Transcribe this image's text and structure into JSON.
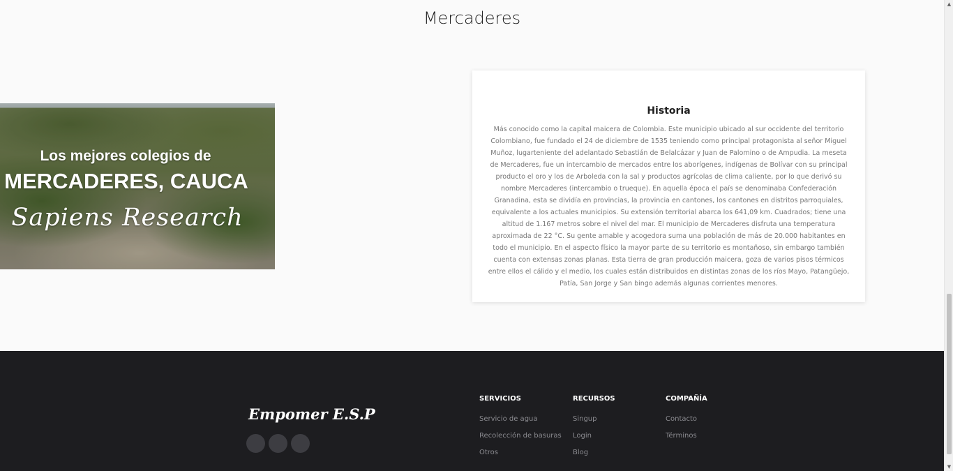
{
  "page": {
    "title": "Mercaderes"
  },
  "hero": {
    "line1": "Los mejores colegios de",
    "line2": "MERCADERES, CAUCA",
    "line3": "Sapiens Research"
  },
  "historia": {
    "title": "Historia",
    "text": "Más conocido como la capital maicera de Colombia. Este municipio ubicado al sur occidente del territorio Colombiano, fue fundado el 24 de diciembre de 1535 teniendo como principal protagonista al señor Miguel Muñoz, lugarteniente del adelantado Sebastián de Belalcázar y Juan de Palomino o de Ampudia. La meseta de Mercaderes, fue un intercambio de mercados entre los aborígenes, indígenas de Bolívar con su principal producto el oro y los de Arboleda con la sal y productos agrícolas de clima caliente, por lo que derivó su nombre Mercaderes (intercambio o trueque). En aquella época el país se denominaba Confederación Granadina, esta se dividía en provincias, la provincia en cantones, los cantones en distritos parroquiales, equivalente a los actuales municipios. Su extensión territorial abarca los 641,09 km. Cuadrados; tiene una altitud de 1.167 metros sobre el nivel del mar. El municipio de Mercaderes disfruta una temperatura aproximada de 22 °C. Su gente amable y acogedora suma una población de más de 20.000 habitantes en todo el municipio. En el aspecto físico la mayor parte de su territorio es montañoso, sin embargo también cuenta con extensas zonas planas. Esta tierra de gran producción maicera, goza de varios pisos térmicos entre ellos el cálido y el medio, los cuales están distribuidos en distintas zonas de los ríos Mayo, Patangüejo, Patía, San Jorge y San bingo además algunas corrientes menores."
  },
  "footer": {
    "brand": "Empomer E.S.P",
    "columns": [
      {
        "title": "SERVICIOS",
        "links": [
          "Servicio de agua",
          "Recolección de basuras",
          "Otros"
        ]
      },
      {
        "title": "RECURSOS",
        "links": [
          "Singup",
          "Login",
          "Blog"
        ]
      },
      {
        "title": "COMPAÑÍA",
        "links": [
          "Contacto",
          "Términos"
        ]
      }
    ]
  },
  "colors": {
    "footer_bg": "#1d1d20",
    "page_bg": "#fafafa"
  }
}
